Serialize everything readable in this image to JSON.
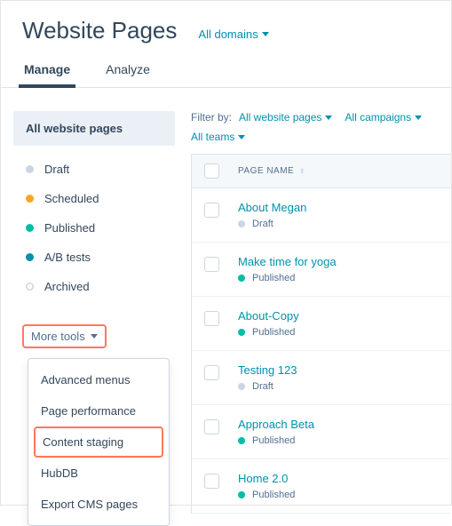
{
  "header": {
    "title": "Website Pages",
    "domains_label": "All domains"
  },
  "tabs": [
    {
      "label": "Manage",
      "active": true
    },
    {
      "label": "Analyze",
      "active": false
    }
  ],
  "sidebar": {
    "all_label": "All website pages",
    "items": [
      {
        "label": "Draft",
        "color": "gray"
      },
      {
        "label": "Scheduled",
        "color": "orange"
      },
      {
        "label": "Published",
        "color": "teal"
      },
      {
        "label": "A/B tests",
        "color": "blue"
      },
      {
        "label": "Archived",
        "color": "hollow"
      }
    ],
    "more_tools_label": "More tools",
    "dropdown": [
      {
        "label": "Advanced menus"
      },
      {
        "label": "Page performance"
      },
      {
        "label": "Content staging",
        "highlight": true
      },
      {
        "label": "HubDB"
      },
      {
        "label": "Export CMS pages"
      }
    ]
  },
  "filters": {
    "label": "Filter by:",
    "items": [
      {
        "label": "All website pages"
      },
      {
        "label": "All campaigns"
      },
      {
        "label": "All teams"
      }
    ]
  },
  "table": {
    "header_col": "PAGE NAME",
    "rows": [
      {
        "title": "About Megan",
        "status": "Draft",
        "color": "gray"
      },
      {
        "title": "Make time for yoga",
        "status": "Published",
        "color": "teal"
      },
      {
        "title": "About-Copy",
        "status": "Published",
        "color": "teal"
      },
      {
        "title": "Testing 123",
        "status": "Draft",
        "color": "gray"
      },
      {
        "title": "Approach Beta",
        "status": "Published",
        "color": "teal"
      },
      {
        "title": "Home 2.0",
        "status": "Published",
        "color": "teal"
      }
    ]
  }
}
